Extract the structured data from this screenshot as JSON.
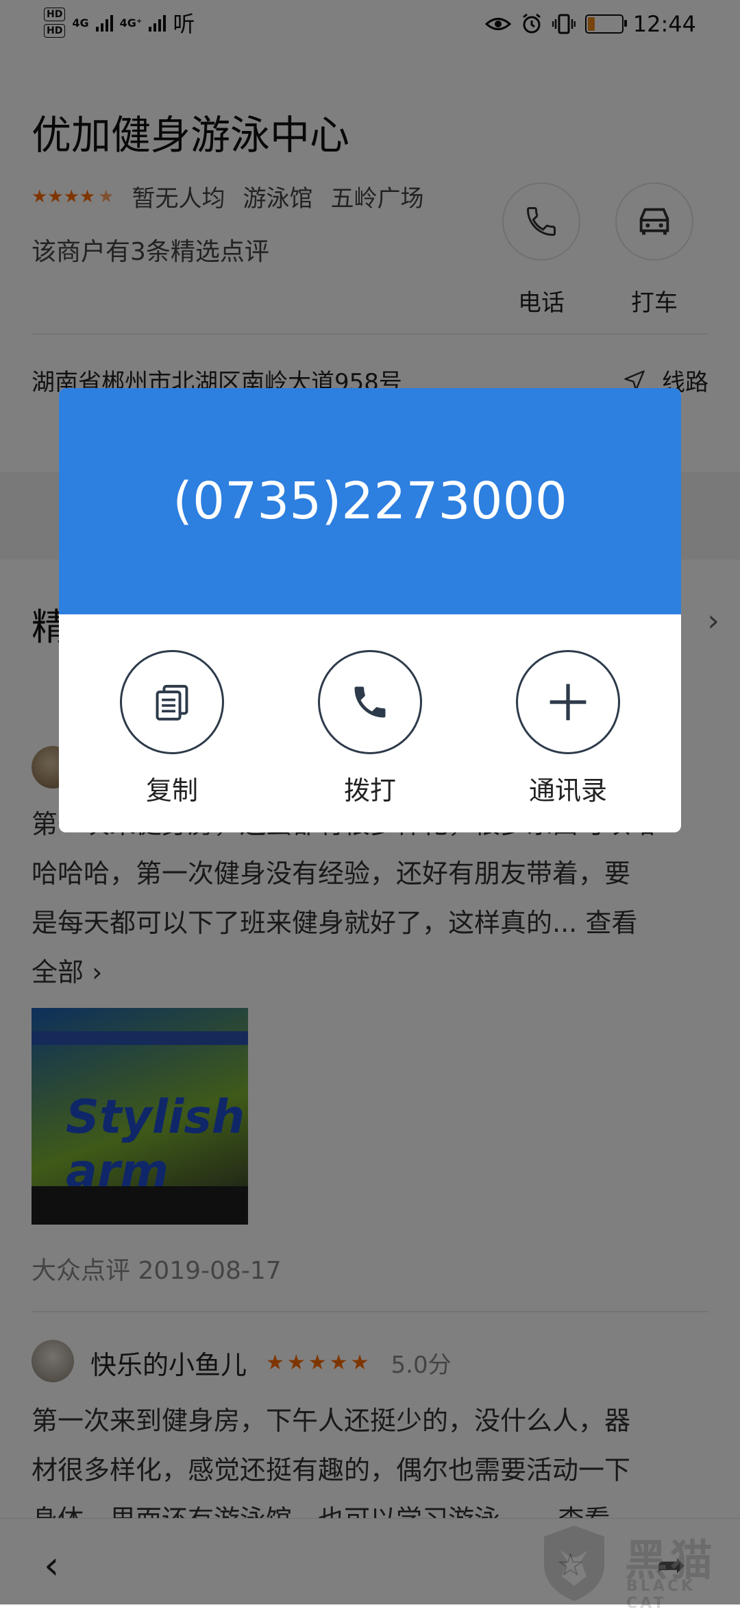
{
  "status_bar": {
    "network_1": "4G",
    "network_2": "4G⁺",
    "hd_1": "HD",
    "hd_2": "HD",
    "listen_label": "听",
    "time": "12:44",
    "battery_level": 0.2
  },
  "merchant": {
    "name": "优加健身游泳中心",
    "rating_stars": 4.5,
    "price": "暂无人均",
    "category": "游泳馆",
    "area": "五岭广场",
    "summary": "该商户有3条精选点评",
    "address": "湖南省郴州市北湖区南岭大道958号",
    "route_label": "线路"
  },
  "actions": {
    "phone_label": "电话",
    "taxi_label": "打车"
  },
  "section": {
    "title": "精选点评"
  },
  "reviews": [
    {
      "text_lines": [
        "第一次来健身房，还蛮都有很多样化，很多东西可以哈",
        "哈哈哈，第一次健身没有经验，还好有朋友带着，要",
        "是每天都可以下了班来健身就好了，这样真的...  查看",
        "全部 ›"
      ],
      "photo_logo": "Stylish arm",
      "source": "大众点评",
      "date": "2019-08-17"
    },
    {
      "user": "快乐的小鱼儿",
      "stars": "★★★★★",
      "score": "5.0分",
      "text_lines": [
        "第一次来到健身房，下午人还挺少的，没什么人，器",
        "材很多样化，感觉还挺有趣的，偶尔也需要活动一下",
        "身体，里面还有游泳馆，也可以学习游泳......  查看"
      ]
    }
  ],
  "dialog": {
    "phone_number": "(0735)2273000",
    "copy_label": "复制",
    "call_label": "拨打",
    "contacts_label": "通讯录"
  },
  "watermark": {
    "text": "黑猫",
    "subtext": "BLACK CAT"
  },
  "colors": {
    "accent": "#2d7fe0",
    "star": "#ff6a00",
    "overlay": "rgba(0,0,0,0.5)"
  }
}
